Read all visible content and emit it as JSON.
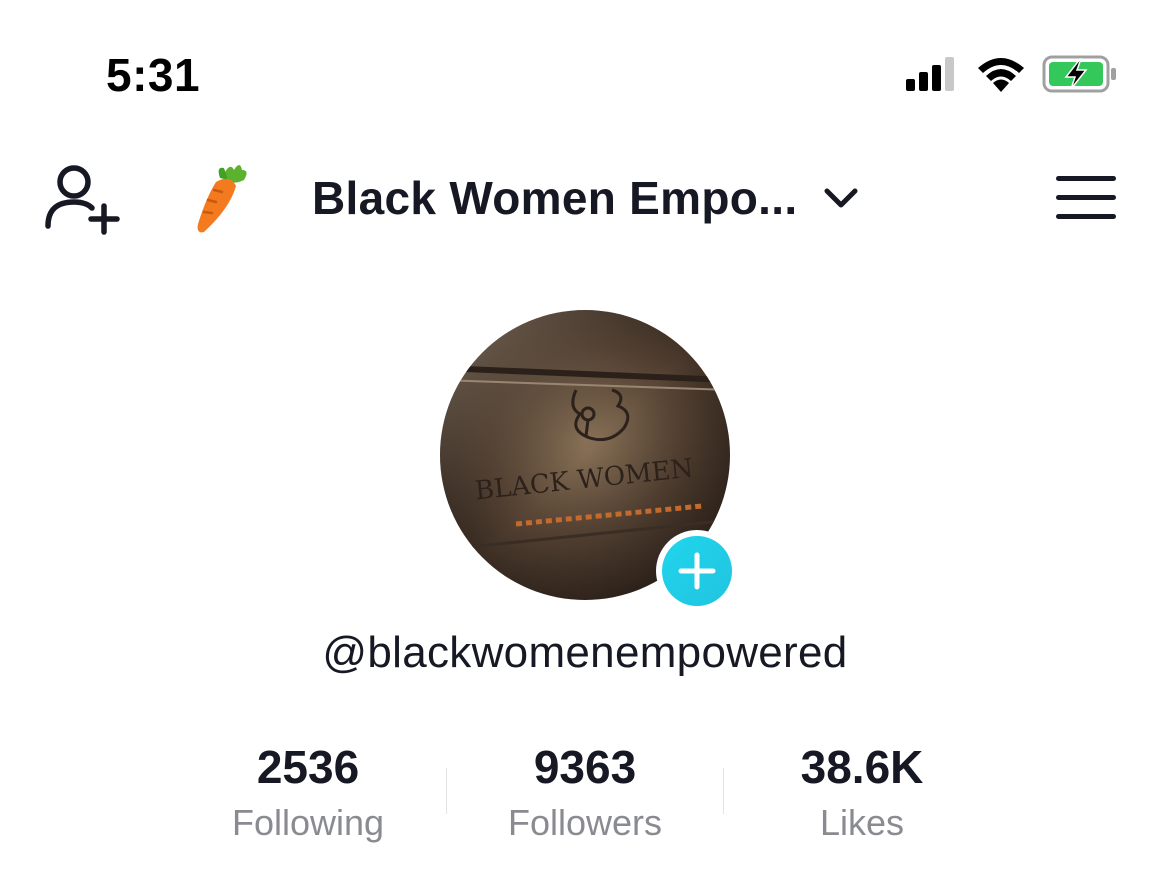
{
  "status_bar": {
    "time": "5:31",
    "icons": [
      "cellular-signal-icon",
      "wifi-icon",
      "battery-charging-icon"
    ]
  },
  "nav": {
    "add_user_icon": "person-add-icon",
    "emoji_icon": "carrot-icon",
    "title": "Black Women Empo...",
    "dropdown_icon": "chevron-down-icon",
    "menu_icon": "hamburger-menu-icon"
  },
  "profile": {
    "avatar_text": "BLACK WOMEN",
    "add_icon": "plus-icon",
    "accent_color": "#20d5ec",
    "username": "@blackwomenempowered"
  },
  "stats": [
    {
      "value": "2536",
      "label": "Following"
    },
    {
      "value": "9363",
      "label": "Followers"
    },
    {
      "value": "38.6K",
      "label": "Likes"
    }
  ]
}
